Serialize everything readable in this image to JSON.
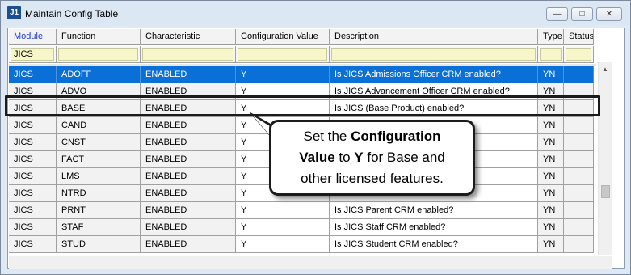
{
  "window": {
    "title": "Maintain Config Table",
    "icon_text": "J1",
    "buttons": {
      "minimize": "—",
      "maximize": "□",
      "close": "✕"
    }
  },
  "columns": [
    "Module",
    "Function",
    "Characteristic",
    "Configuration Value",
    "Description",
    "Type",
    "Status"
  ],
  "filter": {
    "module": "JICS",
    "function": "",
    "characteristic": "",
    "value": "",
    "description": "",
    "type": "",
    "status": ""
  },
  "rows": [
    {
      "module": "JICS",
      "function": "ADOFF",
      "characteristic": "ENABLED",
      "value": "Y",
      "description": "Is JICS Admissions Officer CRM enabled?",
      "type": "YN",
      "status": ""
    },
    {
      "module": "JICS",
      "function": "ADVO",
      "characteristic": "ENABLED",
      "value": "Y",
      "description": "Is JICS Advancement Officer CRM enabled?",
      "type": "YN",
      "status": ""
    },
    {
      "module": "JICS",
      "function": "BASE",
      "characteristic": "ENABLED",
      "value": "Y",
      "description": "Is JICS (Base Product) enabled?",
      "type": "YN",
      "status": ""
    },
    {
      "module": "JICS",
      "function": "CAND",
      "characteristic": "ENABLED",
      "value": "Y",
      "description": "",
      "type": "YN",
      "status": ""
    },
    {
      "module": "JICS",
      "function": "CNST",
      "characteristic": "ENABLED",
      "value": "Y",
      "description": "",
      "type": "YN",
      "status": ""
    },
    {
      "module": "JICS",
      "function": "FACT",
      "characteristic": "ENABLED",
      "value": "Y",
      "description": "",
      "type": "YN",
      "status": ""
    },
    {
      "module": "JICS",
      "function": "LMS",
      "characteristic": "ENABLED",
      "value": "Y",
      "description": "",
      "type": "YN",
      "status": ""
    },
    {
      "module": "JICS",
      "function": "NTRD",
      "characteristic": "ENABLED",
      "value": "Y",
      "description": "",
      "type": "YN",
      "status": ""
    },
    {
      "module": "JICS",
      "function": "PRNT",
      "characteristic": "ENABLED",
      "value": "Y",
      "description": "Is JICS Parent CRM enabled?",
      "type": "YN",
      "status": ""
    },
    {
      "module": "JICS",
      "function": "STAF",
      "characteristic": "ENABLED",
      "value": "Y",
      "description": "Is JICS Staff CRM enabled?",
      "type": "YN",
      "status": ""
    },
    {
      "module": "JICS",
      "function": "STUD",
      "characteristic": "ENABLED",
      "value": "Y",
      "description": "Is JICS Student CRM enabled?",
      "type": "YN",
      "status": ""
    }
  ],
  "callout": {
    "line1_pre": "Set the ",
    "line1_bold": "Configuration",
    "line2_bold": "Value",
    "line2_mid": " to ",
    "line2_bold2": "Y",
    "line2_post": " for Base and",
    "line3": "other licensed features."
  },
  "colors": {
    "selection": "#0a6fd6",
    "filter_bg": "#f6f6c8",
    "header_module": "#1f3bd8"
  }
}
